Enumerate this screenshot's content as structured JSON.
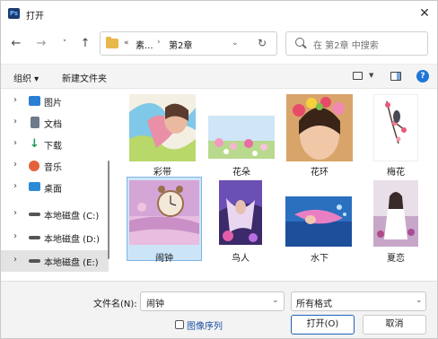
{
  "window": {
    "app_icon_text": "Ps",
    "title": "打开",
    "close_glyph": "✕"
  },
  "nav": {
    "back_glyph": "←",
    "forward_glyph": "→",
    "recent_glyph": "˅",
    "up_glyph": "↑",
    "breadcrumb_overflow": "«",
    "breadcrumbs": [
      "素...",
      "第2章"
    ],
    "breadcrumb_separator": "›",
    "dropdown_glyph": "⌄",
    "refresh_glyph": "↻",
    "search_placeholder": "在 第2章 中搜索"
  },
  "toolbar": {
    "organize_label": "组织 ▾",
    "new_folder_label": "新建文件夹",
    "view_dropdown_glyph": "▼",
    "help_glyph": "?"
  },
  "sidebar": {
    "chevron": "›",
    "items": [
      {
        "label": "图片",
        "icon": "pictures-icon",
        "color": "#2a7fd4"
      },
      {
        "label": "文档",
        "icon": "documents-icon",
        "color": "#6c7a89"
      },
      {
        "label": "下载",
        "icon": "downloads-icon",
        "color": "#1d9a5b"
      },
      {
        "label": "音乐",
        "icon": "music-icon",
        "color": "#e2633a"
      },
      {
        "label": "桌面",
        "icon": "desktop-icon",
        "color": "#2a8ad8"
      },
      {
        "label": "本地磁盘 (C:)",
        "icon": "drive-icon",
        "color": "#555555"
      },
      {
        "label": "本地磁盘 (D:)",
        "icon": "drive-icon",
        "color": "#555555"
      },
      {
        "label": "本地磁盘 (E:)",
        "icon": "drive-icon",
        "color": "#555555",
        "selected": true
      }
    ]
  },
  "files": [
    {
      "name": "彩带",
      "icon": "image-thumbnail-ribbon"
    },
    {
      "name": "花朵",
      "icon": "image-thumbnail-flowers"
    },
    {
      "name": "花环",
      "icon": "image-thumbnail-wreath"
    },
    {
      "name": "梅花",
      "icon": "image-thumbnail-plum"
    },
    {
      "name": "闹钟",
      "icon": "image-thumbnail-clock",
      "selected": true
    },
    {
      "name": "鸟人",
      "icon": "image-thumbnail-birdman"
    },
    {
      "name": "水下",
      "icon": "image-thumbnail-underwater"
    },
    {
      "name": "夏恋",
      "icon": "image-thumbnail-summer"
    }
  ],
  "footer": {
    "filename_label": "文件名(N):",
    "filename_value": "闹钟",
    "dropdown_glyph": "⌄",
    "filter_value": "所有格式",
    "image_sequence_label": "图像序列",
    "open_label": "打开(O)",
    "cancel_label": "取消"
  },
  "colors": {
    "accent": "#1f62b5",
    "selection": "#cce4f7",
    "help_icon": "#1e77d8",
    "folder": "#e8b84a"
  }
}
